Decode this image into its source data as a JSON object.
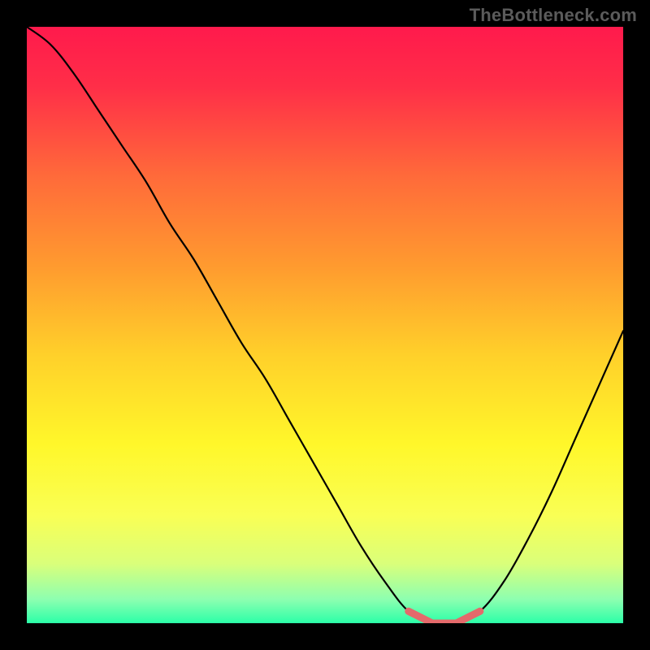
{
  "attribution": "TheBottleneck.com",
  "colors": {
    "frame": "#000000",
    "gradient_stops": [
      {
        "offset": 0.0,
        "color": "#ff1a4c"
      },
      {
        "offset": 0.1,
        "color": "#ff2e48"
      },
      {
        "offset": 0.25,
        "color": "#ff6a3a"
      },
      {
        "offset": 0.4,
        "color": "#ff9a2f"
      },
      {
        "offset": 0.55,
        "color": "#ffd02a"
      },
      {
        "offset": 0.7,
        "color": "#fff72a"
      },
      {
        "offset": 0.82,
        "color": "#f9ff55"
      },
      {
        "offset": 0.9,
        "color": "#daff7a"
      },
      {
        "offset": 0.96,
        "color": "#8dffb0"
      },
      {
        "offset": 1.0,
        "color": "#2bffa8"
      }
    ],
    "curve": "#000000",
    "valley_marker": "#e46a6b"
  },
  "chart_data": {
    "type": "line",
    "title": "",
    "xlabel": "",
    "ylabel": "",
    "xlim": [
      0,
      100
    ],
    "ylim": [
      0,
      100
    ],
    "grid": false,
    "series": [
      {
        "name": "bottleneck-curve",
        "x": [
          0,
          4,
          8,
          12,
          16,
          20,
          24,
          28,
          32,
          36,
          40,
          44,
          48,
          52,
          56,
          60,
          64,
          68,
          72,
          76,
          80,
          84,
          88,
          92,
          96,
          100
        ],
        "y": [
          100,
          97,
          92,
          86,
          80,
          74,
          67,
          61,
          54,
          47,
          41,
          34,
          27,
          20,
          13,
          7,
          2,
          0,
          0,
          2,
          7,
          14,
          22,
          31,
          40,
          49
        ]
      }
    ],
    "valley_range_x": [
      63,
      77
    ],
    "annotations": []
  }
}
